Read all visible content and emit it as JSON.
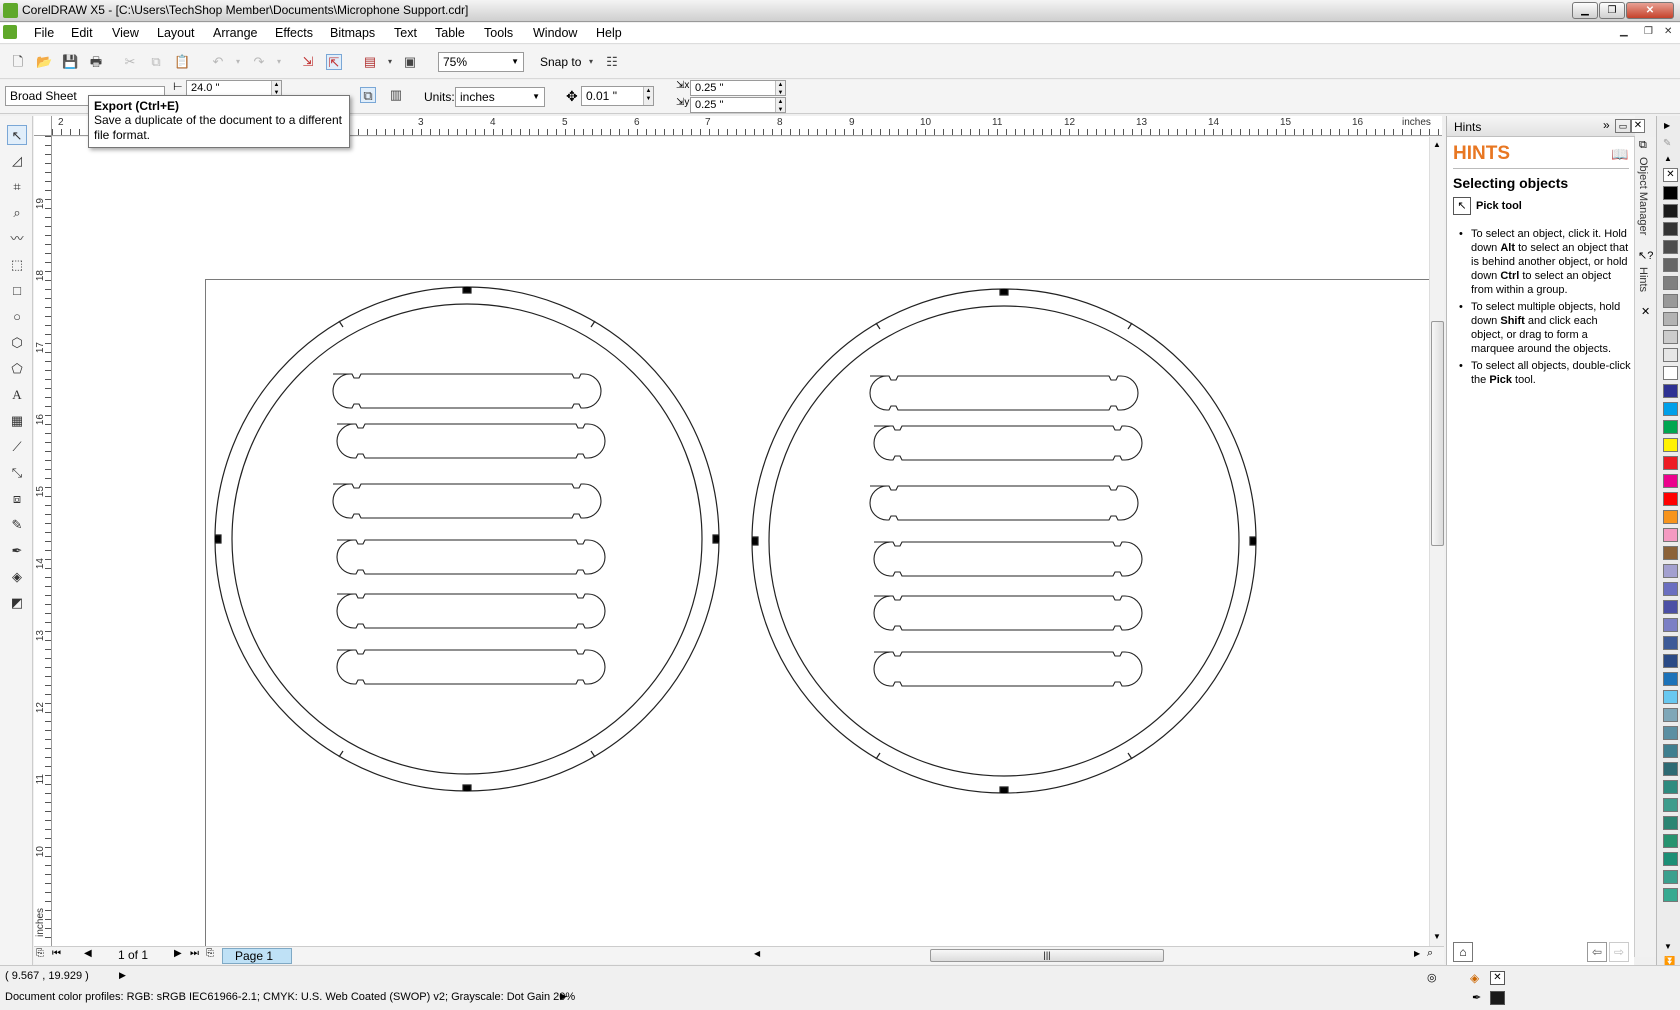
{
  "window": {
    "title": "CorelDRAW X5 - [C:\\Users\\TechShop Member\\Documents\\Microphone Support.cdr]"
  },
  "menu": {
    "items": [
      "File",
      "Edit",
      "View",
      "Layout",
      "Arrange",
      "Effects",
      "Bitmaps",
      "Text",
      "Table",
      "Tools",
      "Window",
      "Help"
    ]
  },
  "toolbar": {
    "zoom": "75%",
    "snap_to": "Snap to"
  },
  "propbar": {
    "paper_preset": "Broad Sheet",
    "width": "24.0 \"",
    "units_label": "Units:",
    "units_value": "inches",
    "nudge": "0.01 \"",
    "dup_x": "0.25 \"",
    "dup_y": "0.25 \""
  },
  "tooltip": {
    "title": "Export (Ctrl+E)",
    "desc": "Save a duplicate of the document to a different file format."
  },
  "ruler": {
    "h_labels": [
      "2",
      "3",
      "4",
      "5",
      "6",
      "7",
      "8",
      "9",
      "10",
      "11",
      "12",
      "13",
      "14",
      "15",
      "16",
      "inches"
    ],
    "v_labels": [
      "19",
      "18",
      "17",
      "16",
      "15",
      "14",
      "13",
      "12",
      "11",
      "10",
      "inches"
    ]
  },
  "navigator": {
    "page_count": "1 of 1",
    "page_tab": "Page 1"
  },
  "status": {
    "coords": "( 9.567 , 19.929 )",
    "profiles": "Document color profiles: RGB: sRGB IEC61966-2.1; CMYK: U.S. Web Coated (SWOP) v2; Grayscale: Dot Gain 20%"
  },
  "docker": {
    "header": "Hints",
    "big_title": "HINTS",
    "topic": "Selecting objects",
    "tool_label": "Pick tool",
    "bullets": [
      {
        "t1": "To select an object, click it. Hold down ",
        "b1": "Alt",
        "t2": " to select an object that is behind another object, or hold down ",
        "b2": "Ctrl",
        "t3": " to select an object from within a group."
      },
      {
        "t1": "To select multiple objects, hold down ",
        "b1": "Shift",
        "t2": " and click each object, or drag to form a marquee around the objects.",
        "b2": "",
        "t3": ""
      },
      {
        "t1": "To select all objects, double-click the ",
        "b1": "Pick",
        "t2": " tool.",
        "b2": "",
        "t3": ""
      }
    ],
    "tabs": [
      "Object Manager",
      "Hints"
    ]
  },
  "colors": {
    "accent_orange": "#e87722",
    "page_tab_blue": "#bfe1f6",
    "palette": [
      "#000000",
      "#1a1a1a",
      "#333333",
      "#4d4d4d",
      "#666666",
      "#808080",
      "#999999",
      "#b3b3b3",
      "#cccccc",
      "#e6e6e6",
      "#ffffff",
      "#2e3192",
      "#00a0e9",
      "#00a650",
      "#fff200",
      "#ed1c24",
      "#ec008c",
      "#ff0000",
      "#f7941d",
      "#f49ac1",
      "#8c6239",
      "#a3a0cf",
      "#6b6fc0",
      "#4b4fa5",
      "#7b7fc5",
      "#3d5a98",
      "#2a4a86",
      "#1c72b8",
      "#68c8f0",
      "#7fa7b8",
      "#5b8fa2",
      "#3f7f8f",
      "#2d6a73",
      "#2e8b7f",
      "#3d9c8c",
      "#2c8573",
      "#26936f",
      "#1c8f76",
      "#3aa08e",
      "#37aa91"
    ]
  }
}
